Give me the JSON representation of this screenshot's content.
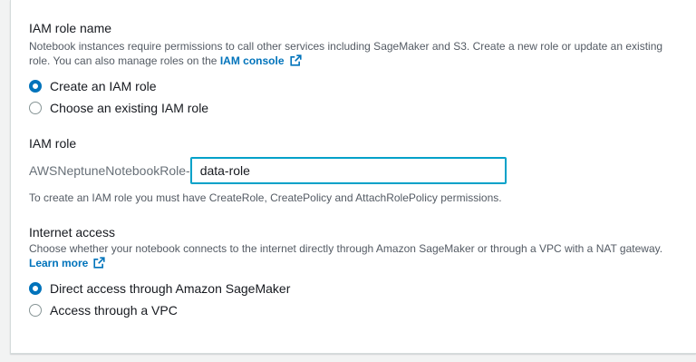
{
  "iam_role_name": {
    "title": "IAM role name",
    "description": "Notebook instances require permissions to call other services including SageMaker and S3. Create a new role or update an existing role. You can also manage roles on the",
    "link_label": "IAM console",
    "options": [
      {
        "label": "Create an IAM role",
        "selected": true
      },
      {
        "label": "Choose an existing IAM role",
        "selected": false
      }
    ]
  },
  "iam_role": {
    "title": "IAM role",
    "prefix": "AWSNeptuneNotebookRole-",
    "value": "data-role",
    "hint": "To create an IAM role you must have CreateRole, CreatePolicy and AttachRolePolicy permissions."
  },
  "internet_access": {
    "title": "Internet access",
    "description": "Choose whether your notebook connects to the internet directly through Amazon SageMaker or through a VPC with a NAT gateway.",
    "link_label": "Learn more",
    "options": [
      {
        "label": "Direct access through Amazon SageMaker",
        "selected": true
      },
      {
        "label": "Access through a VPC",
        "selected": false
      }
    ]
  },
  "colors": {
    "accent": "#0073bb",
    "input_focus": "#00a1c9",
    "muted_text": "#545b64"
  },
  "icons": {
    "external_link": "external-link-icon"
  }
}
